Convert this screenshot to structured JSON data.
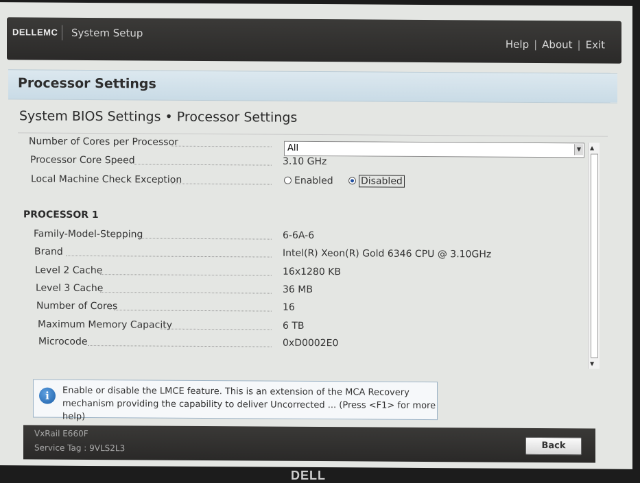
{
  "header": {
    "logo_text": "DELLEMC",
    "app_title": "System Setup",
    "links": [
      "Help",
      "About",
      "Exit"
    ]
  },
  "page": {
    "title": "Processor Settings",
    "breadcrumb": "System BIOS Settings • Processor Settings"
  },
  "settings": {
    "cores_label": "Number of Cores per Processor",
    "cores_value": "All",
    "speed_label": "Processor Core Speed",
    "speed_value": "3.10 GHz",
    "lmce_label": "Local Machine Check Exception",
    "lmce_options": [
      "Enabled",
      "Disabled"
    ],
    "lmce_selected": "Disabled"
  },
  "processor1": {
    "heading": "PROCESSOR 1",
    "rows": [
      {
        "label": "Family-Model-Stepping",
        "value": "6-6A-6"
      },
      {
        "label": "Brand",
        "value": "Intel(R) Xeon(R) Gold 6346 CPU @ 3.10GHz"
      },
      {
        "label": "Level 2 Cache",
        "value": "16x1280 KB"
      },
      {
        "label": "Level 3 Cache",
        "value": "36 MB"
      },
      {
        "label": "Number of Cores",
        "value": "16"
      },
      {
        "label": "Maximum Memory Capacity",
        "value": "6 TB"
      },
      {
        "label": "Microcode",
        "value": "0xD0002E0"
      }
    ]
  },
  "help": {
    "line1": "Enable or disable the LMCE feature. This is an extension of the MCA Recovery",
    "line2": "mechanism providing the capability to deliver Uncorrected ... (Press <F1> for more help)"
  },
  "footer": {
    "model": "VxRail E660F",
    "service_tag": "Service Tag : 9VLS2L3",
    "back_label": "Back"
  },
  "bezel": {
    "logo_text": "DELL"
  }
}
